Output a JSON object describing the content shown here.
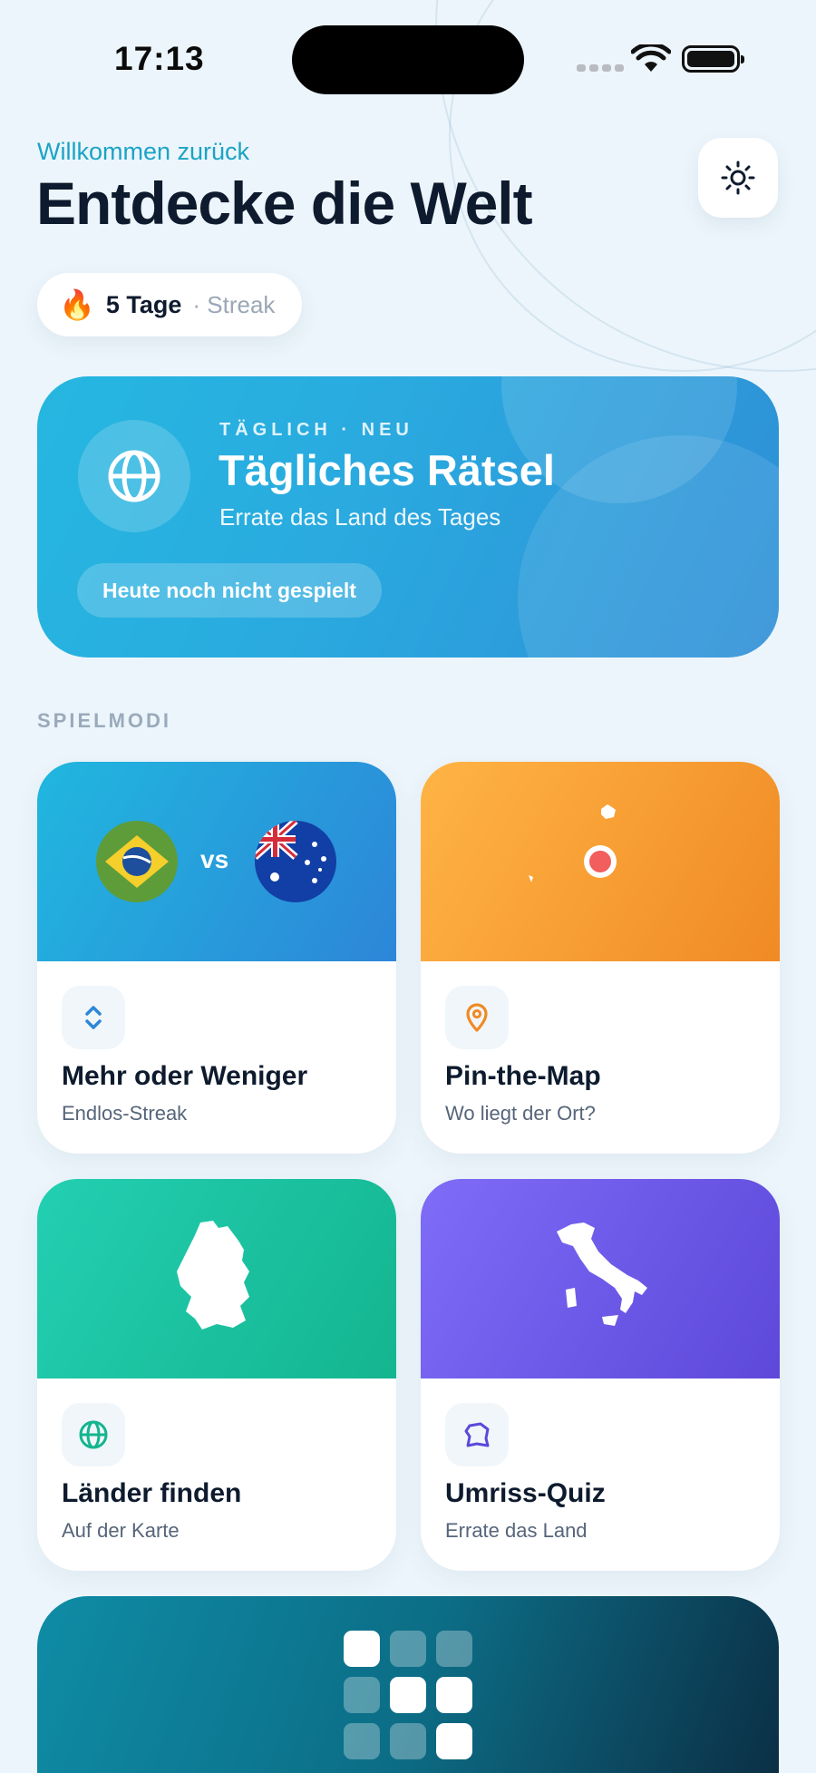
{
  "status_bar": {
    "time": "17:13"
  },
  "header": {
    "welcome": "Willkommen zurück",
    "title": "Entdecke die Welt",
    "theme_icon": "sun-icon"
  },
  "streak": {
    "icon": "fire-icon",
    "emoji": "🔥",
    "days": "5 Tage",
    "label": "· Streak"
  },
  "daily": {
    "tag": "TÄGLICH · NEU",
    "title": "Tägliches Rätsel",
    "subtitle": "Errate das Land des Tages",
    "status": "Heute noch nicht gespielt",
    "icon": "globe-icon"
  },
  "section_label": "SPIELMODI",
  "modes": [
    {
      "title": "Mehr oder Weniger",
      "subtitle": "Endlos-Streak",
      "icon": "up-down-chevron-icon",
      "vs": "vs",
      "accent": "#2d86d8"
    },
    {
      "title": "Pin-the-Map",
      "subtitle": "Wo liegt der Ort?",
      "icon": "map-pin-icon",
      "accent": "#f08a24"
    },
    {
      "title": "Länder finden",
      "subtitle": "Auf der Karte",
      "icon": "globe-icon",
      "accent": "#14b58f"
    },
    {
      "title": "Umriss-Quiz",
      "subtitle": "Errate das Land",
      "icon": "outline-shape-icon",
      "accent": "#5d48da"
    }
  ],
  "colors": {
    "background": "#ecf5fb",
    "accent_text": "#1aa4c5",
    "title": "#0e1b2e"
  }
}
